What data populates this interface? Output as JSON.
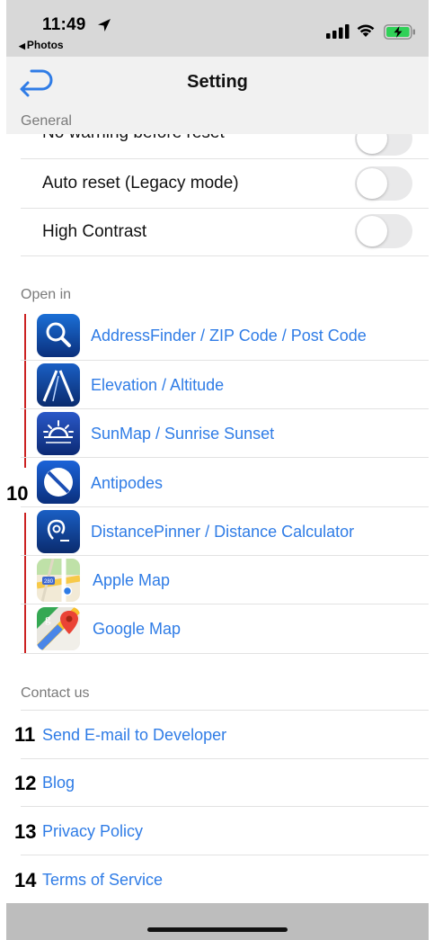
{
  "status_bar": {
    "time": "11:49",
    "back_app": "Photos",
    "icons": [
      "location-arrow-icon",
      "cellular-signal-icon",
      "wifi-icon",
      "battery-charging-icon"
    ],
    "battery_color": "#30d158"
  },
  "nav": {
    "title": "Setting",
    "back_icon": "return-arrow-icon"
  },
  "general": {
    "header": "General",
    "partial_label": "No warning before reset",
    "toggles": [
      {
        "label": "Auto reset (Legacy mode)",
        "on": false
      },
      {
        "label": "High Contrast",
        "on": false
      }
    ]
  },
  "open_in": {
    "header": "Open in",
    "items": [
      {
        "label": "AddressFinder / ZIP Code / Post Code",
        "icon": "magnifier-icon"
      },
      {
        "label": "Elevation / Altitude",
        "icon": "road-perspective-icon"
      },
      {
        "label": "SunMap / Sunrise Sunset",
        "icon": "sunrise-icon"
      },
      {
        "label": "Antipodes",
        "icon": "antipodes-globe-icon"
      },
      {
        "label": "DistancePinner / Distance Calculator",
        "icon": "distance-pin-icon"
      },
      {
        "label": "Apple Map",
        "icon": "apple-maps-icon"
      },
      {
        "label": "Google Map",
        "icon": "google-maps-icon"
      }
    ],
    "annotation_number": "10"
  },
  "contact": {
    "header": "Contact us",
    "links": [
      {
        "label": "Send E-mail to Developer",
        "number": "11"
      },
      {
        "label": "Blog",
        "number": "12"
      },
      {
        "label": "Privacy Policy",
        "number": "13"
      },
      {
        "label": "Terms of Service",
        "number": "14"
      }
    ]
  },
  "colors": {
    "link": "#2f7ce6",
    "section_header": "#7a7a7a",
    "annotation_line": "#cc2222"
  }
}
